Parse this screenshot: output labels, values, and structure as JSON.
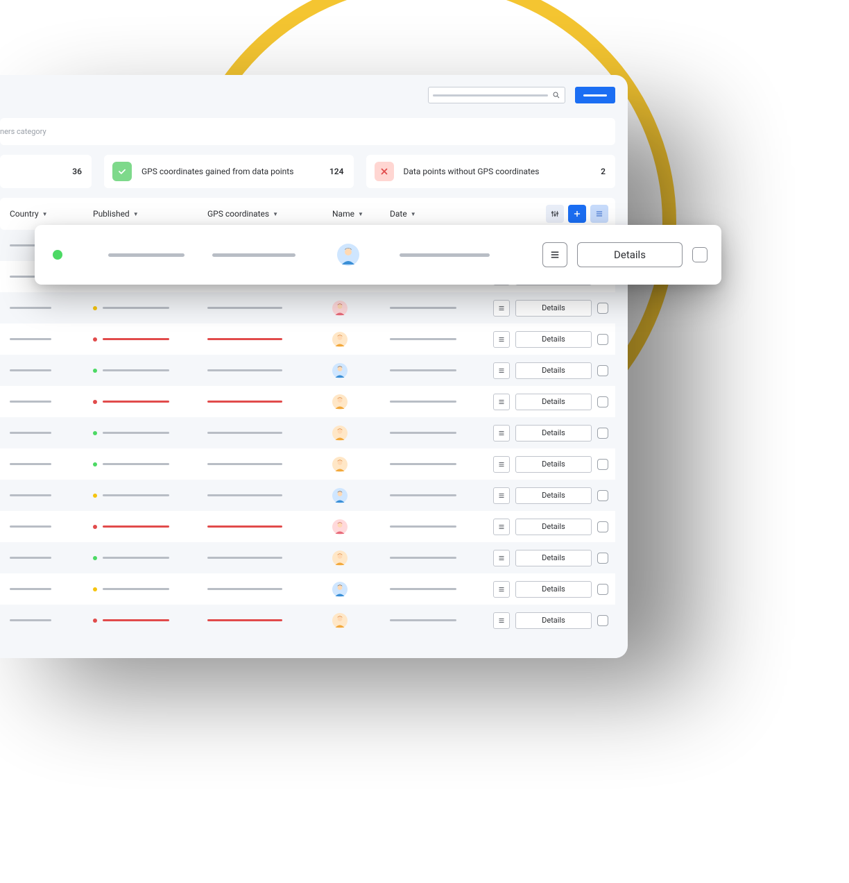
{
  "subheader": {
    "text": "ners category"
  },
  "stats": [
    {
      "label": "",
      "value": "36"
    },
    {
      "label": "GPS coordinates gained from data points",
      "value": "124",
      "icon": "check"
    },
    {
      "label": "Data points without GPS  coordinates",
      "value": "2",
      "icon": "x"
    }
  ],
  "columns": {
    "country": "Country",
    "published": "Published",
    "gps": "GPS coordinates",
    "name": "Name",
    "date": "Date"
  },
  "details_label": "Details",
  "float_row": {
    "details_label": "Details"
  },
  "rows": [
    {
      "status": "green",
      "red_text": false,
      "avatar": "blue",
      "shade": "odd"
    },
    {
      "status": "green",
      "red_text": false,
      "avatar": "orange",
      "shade": "even"
    },
    {
      "status": "yellow",
      "red_text": false,
      "avatar": "pink",
      "shade": "odd"
    },
    {
      "status": "red",
      "red_text": true,
      "avatar": "orange",
      "shade": "even"
    },
    {
      "status": "green",
      "red_text": false,
      "avatar": "blue",
      "shade": "odd"
    },
    {
      "status": "red",
      "red_text": true,
      "avatar": "orange",
      "shade": "even"
    },
    {
      "status": "green",
      "red_text": false,
      "avatar": "orange",
      "shade": "odd"
    },
    {
      "status": "green",
      "red_text": false,
      "avatar": "orange",
      "shade": "even"
    },
    {
      "status": "yellow",
      "red_text": false,
      "avatar": "blue",
      "shade": "odd"
    },
    {
      "status": "red",
      "red_text": true,
      "avatar": "pink",
      "shade": "even"
    },
    {
      "status": "green",
      "red_text": false,
      "avatar": "orange",
      "shade": "odd"
    },
    {
      "status": "yellow",
      "red_text": false,
      "avatar": "blue",
      "shade": "even"
    },
    {
      "status": "red",
      "red_text": true,
      "avatar": "orange",
      "shade": "odd"
    }
  ]
}
